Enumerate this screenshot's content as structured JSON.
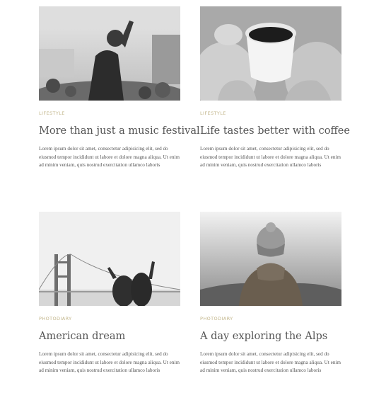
{
  "posts": [
    {
      "category": "Lifestyle",
      "title": "More than just a music festival",
      "excerpt": "Lorem ipsum dolor sit amet, consectetur adipisicing elit, sed do eiusmod tempor incididunt ut labore et dolore magna aliqua. Ut enim ad minim veniam, quis nostrud exercitation ullamco laboris"
    },
    {
      "category": "Lifestyle",
      "title": "Life tastes better with coffee",
      "excerpt": "Lorem ipsum dolor sit amet, consectetur adipisicing elit, sed do eiusmod tempor incididunt ut labore et dolore magna aliqua. Ut enim ad minim veniam, quis nostrud exercitation ullamco laboris"
    },
    {
      "category": "Photodiary",
      "title": "American dream",
      "excerpt": "Lorem ipsum dolor sit amet, consectetur adipisicing elit, sed do eiusmod tempor incididunt ut labore et dolore magna aliqua. Ut enim ad minim veniam, quis nostrud exercitation ullamco laboris"
    },
    {
      "category": "Photodiary",
      "title": "A day exploring the Alps",
      "excerpt": "Lorem ipsum dolor sit amet, consectetur adipisicing elit, sed do eiusmod tempor incididunt ut labore et dolore magna aliqua. Ut enim ad minim veniam, quis nostrud exercitation ullamco laboris"
    }
  ],
  "images": [
    {
      "icon": "concert-photo"
    },
    {
      "icon": "coffee-cup-photo"
    },
    {
      "icon": "golden-gate-bridge-photo"
    },
    {
      "icon": "hiker-beanie-photo"
    }
  ],
  "colors": {
    "category": "#c2b58a",
    "title": "#555555",
    "text": "#555555"
  }
}
